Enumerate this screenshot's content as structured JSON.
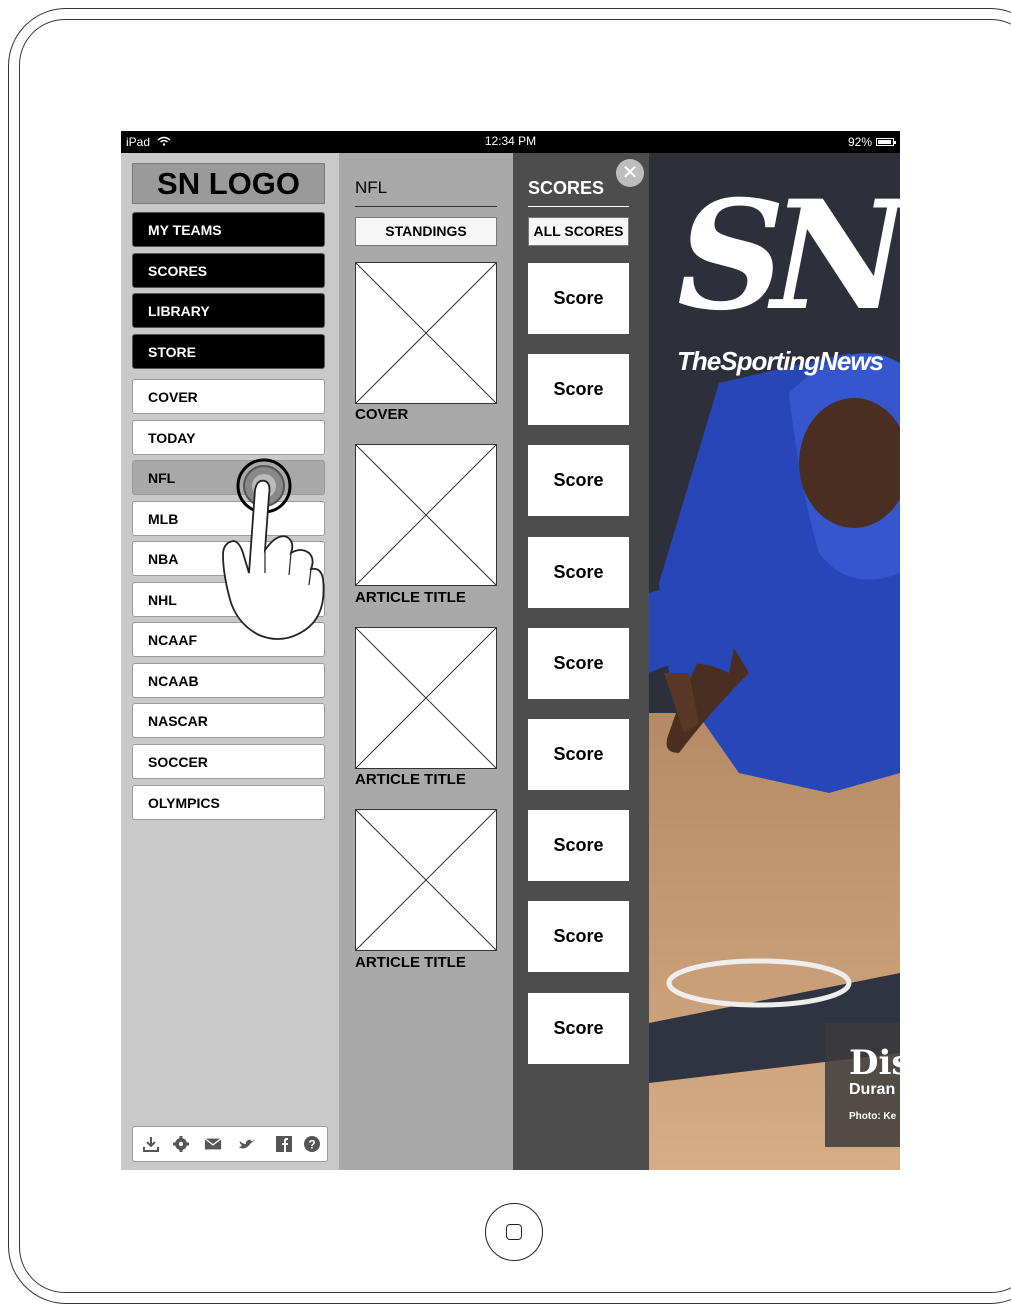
{
  "status_bar": {
    "device": "iPad",
    "time": "12:34 PM",
    "battery": "92%"
  },
  "left_menu": {
    "logo": "SN LOGO",
    "primary_items": [
      "MY TEAMS",
      "SCORES",
      "LIBRARY",
      "STORE"
    ],
    "section_items": [
      "COVER",
      "TODAY",
      "NFL",
      "MLB",
      "NBA",
      "NHL",
      "NCAAF",
      "NCAAB",
      "NASCAR",
      "SOCCER",
      "OLYMPICS"
    ],
    "active_item": "NFL",
    "footer_icons": [
      "download-icon",
      "gear-icon",
      "mail-icon",
      "twitter-icon",
      "facebook-icon",
      "help-icon"
    ]
  },
  "middle_panel": {
    "title": "NFL",
    "standings_label": "STANDINGS",
    "articles": [
      "COVER",
      "ARTICLE TITLE",
      "ARTICLE TITLE",
      "ARTICLE TITLE"
    ]
  },
  "scores_panel": {
    "title": "SCORES",
    "all_scores_label": "ALL SCORES",
    "close_icon": "close-icon",
    "scores": [
      "Score",
      "Score",
      "Score",
      "Score",
      "Score",
      "Score",
      "Score",
      "Score",
      "Score"
    ]
  },
  "cover": {
    "logo_text": "SN",
    "brand": "TheSportingNews",
    "headline": "Dis",
    "subhead": "Duran",
    "photo_credit": "Photo: Ke"
  }
}
